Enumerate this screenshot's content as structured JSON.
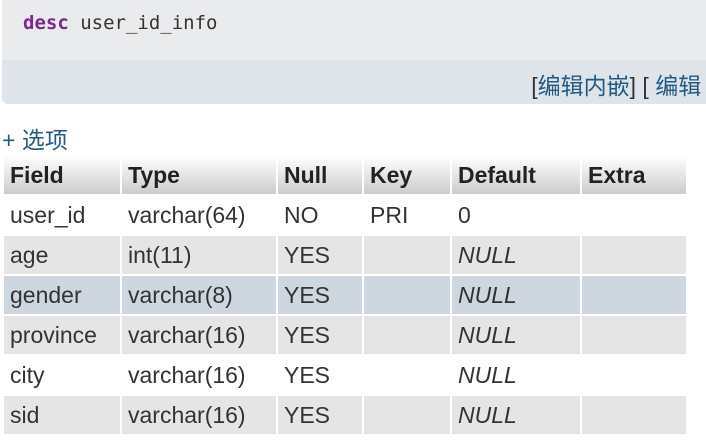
{
  "sql": {
    "keyword": "desc",
    "rest": " user_id_info"
  },
  "sql_actions": {
    "open1": "[",
    "edit_inline": "编辑内嵌",
    "mid": "] [ ",
    "edit": "编辑",
    "close": " ]"
  },
  "options_toggle": "+ 选项",
  "table": {
    "headers": [
      "Field",
      "Type",
      "Null",
      "Key",
      "Default",
      "Extra"
    ],
    "rows": [
      {
        "field": "user_id",
        "type": "varchar(64)",
        "null": "NO",
        "key": "PRI",
        "default": "0",
        "extra": ""
      },
      {
        "field": "age",
        "type": "int(11)",
        "null": "YES",
        "key": "",
        "default": "NULL",
        "extra": ""
      },
      {
        "field": "gender",
        "type": "varchar(8)",
        "null": "YES",
        "key": "",
        "default": "NULL",
        "extra": ""
      },
      {
        "field": "province",
        "type": "varchar(16)",
        "null": "YES",
        "key": "",
        "default": "NULL",
        "extra": ""
      },
      {
        "field": "city",
        "type": "varchar(16)",
        "null": "YES",
        "key": "",
        "default": "NULL",
        "extra": ""
      },
      {
        "field": "sid",
        "type": "varchar(16)",
        "null": "YES",
        "key": "",
        "default": "NULL",
        "extra": ""
      }
    ]
  },
  "colors": {
    "link": "#235a81",
    "sql_keyword": "#7a2a8a",
    "row_hover": "#ced6df",
    "row_even": "#e5e5e5"
  }
}
